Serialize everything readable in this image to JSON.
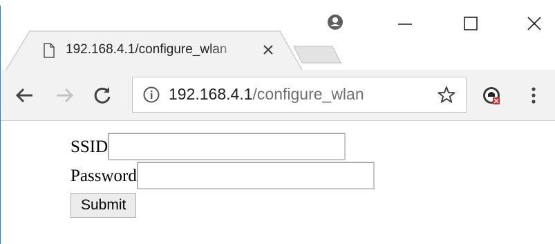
{
  "browser": {
    "tab": {
      "title": "192.168.4.1/configure_wlan",
      "close_glyph": "×"
    },
    "window_controls": {
      "minimize_glyph": "—",
      "maximize_glyph": "☐",
      "close_glyph": "✕"
    },
    "toolbar": {
      "url_host": "192.168.4.1",
      "url_path": "/configure_wlan"
    },
    "icons": [
      "document-icon",
      "profile-icon",
      "back-arrow-icon",
      "forward-arrow-icon",
      "reload-icon",
      "info-icon",
      "star-icon",
      "extension-icon",
      "menu-kebab-icon"
    ],
    "colors": {
      "toolbar_bg": "#f2f2f2",
      "window_border": "#2b7bd6",
      "url_host": "#202020",
      "url_path": "#6f6f6f"
    }
  },
  "form": {
    "ssid_label": "SSID",
    "ssid_value": "",
    "password_label": "Password",
    "password_value": "",
    "submit_label": "Submit"
  }
}
